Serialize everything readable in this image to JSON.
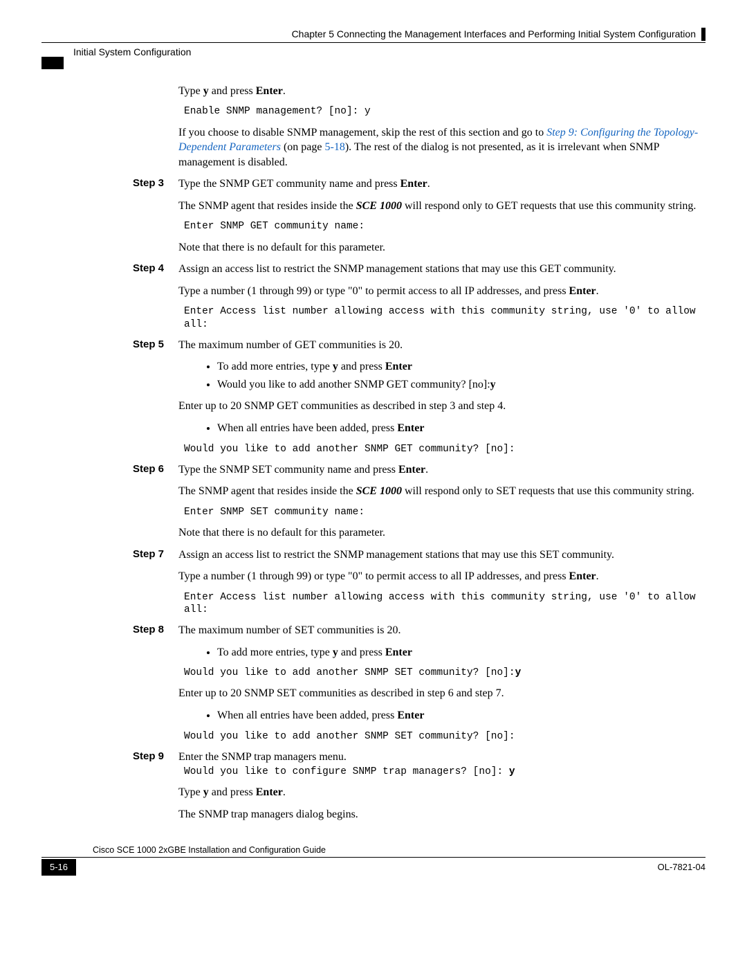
{
  "header": {
    "chapter": "Chapter 5      Connecting the Management Interfaces and Performing Initial System Configuration",
    "section": "Initial System Configuration"
  },
  "intro": {
    "type_y": "Type ",
    "y": "y",
    "and_press": " and press ",
    "enter": "Enter",
    "period": ".",
    "code1": "Enable SNMP management? [no]: y",
    "disable_text_1": "If you choose to disable SNMP management, skip the rest of this section and go to ",
    "link_text": "Step 9: Configuring the Topology-Dependent Parameters",
    "on_page": " (on page ",
    "page_link": "5-18",
    "disable_text_2": "). The rest of the dialog is not presented, as it is irrelevant when SNMP management is disabled."
  },
  "step3": {
    "label": "Step 3",
    "l1a": "Type the SNMP GET community name and press ",
    "l1b": "Enter",
    "l1c": ".",
    "l2a": "The SNMP agent that resides inside the ",
    "l2b": "SCE 1000",
    "l2c": " will respond only to GET requests that use this community string.",
    "code": "Enter SNMP GET community name:",
    "l3": "Note that there is no default for this parameter."
  },
  "step4": {
    "label": "Step 4",
    "l1": "Assign an access list to restrict the SNMP management stations that may use this GET community.",
    "l2a": "Type a number (1 through 99) or type \"0\" to permit access to all IP addresses, and press ",
    "l2b": "Enter",
    "l2c": ".",
    "code": "Enter Access list number allowing access with this community string, use '0' to allow all:"
  },
  "step5": {
    "label": "Step 5",
    "l1": "The maximum number of GET communities is 20.",
    "b1a": "To add more entries, type ",
    "b1b": "y",
    "b1c": " and press ",
    "b1d": "Enter",
    "b2a": "Would you like to add another SNMP GET community? [no]:",
    "b2b": "y",
    "l2": "Enter up to 20 SNMP GET communities as described in step 3 and step 4.",
    "b3a": "When all entries have been added, press ",
    "b3b": "Enter",
    "code": "Would you like to add another SNMP GET community? [no]:"
  },
  "step6": {
    "label": "Step 6",
    "l1a": "Type the SNMP SET community name and press ",
    "l1b": "Enter",
    "l1c": ".",
    "l2a": "The SNMP agent that resides inside the ",
    "l2b": "SCE 1000",
    "l2c": " will respond only to SET requests that use this community string.",
    "code": "Enter SNMP SET community name:",
    "l3": "Note that there is no default for this parameter."
  },
  "step7": {
    "label": "Step 7",
    "l1": "Assign an access list to restrict the SNMP management stations that may use this SET community.",
    "l2a": "Type a number (1 through 99) or type \"0\" to permit access to all IP addresses, and press ",
    "l2b": "Enter",
    "l2c": ".",
    "code": "Enter Access list number allowing access with this community string, use '0' to allow all:"
  },
  "step8": {
    "label": "Step 8",
    "l1": "The maximum number of SET communities is 20.",
    "b1a": "To add more entries, type ",
    "b1b": "y",
    "b1c": " and press ",
    "b1d": "Enter",
    "code1a": "Would you like to add another SNMP SET community? [no]:",
    "code1b": "y",
    "l2": "Enter up to 20 SNMP SET communities as described in step 6 and step 7.",
    "b2a": "When all entries have been added, press ",
    "b2b": "Enter",
    "code2": "Would you like to add another SNMP SET community? [no]:"
  },
  "step9": {
    "label": "Step 9",
    "l1": "Enter the SNMP trap managers menu.",
    "code_a": "Would you like to configure SNMP trap managers? [no]: ",
    "code_b": "y",
    "l2a": "Type ",
    "l2b": "y",
    "l2c": " and press ",
    "l2d": "Enter",
    "l2e": ".",
    "l3": "The SNMP trap managers dialog begins."
  },
  "footer": {
    "guide": "Cisco SCE 1000 2xGBE Installation and Configuration Guide",
    "page": "5-16",
    "docid": "OL-7821-04"
  }
}
